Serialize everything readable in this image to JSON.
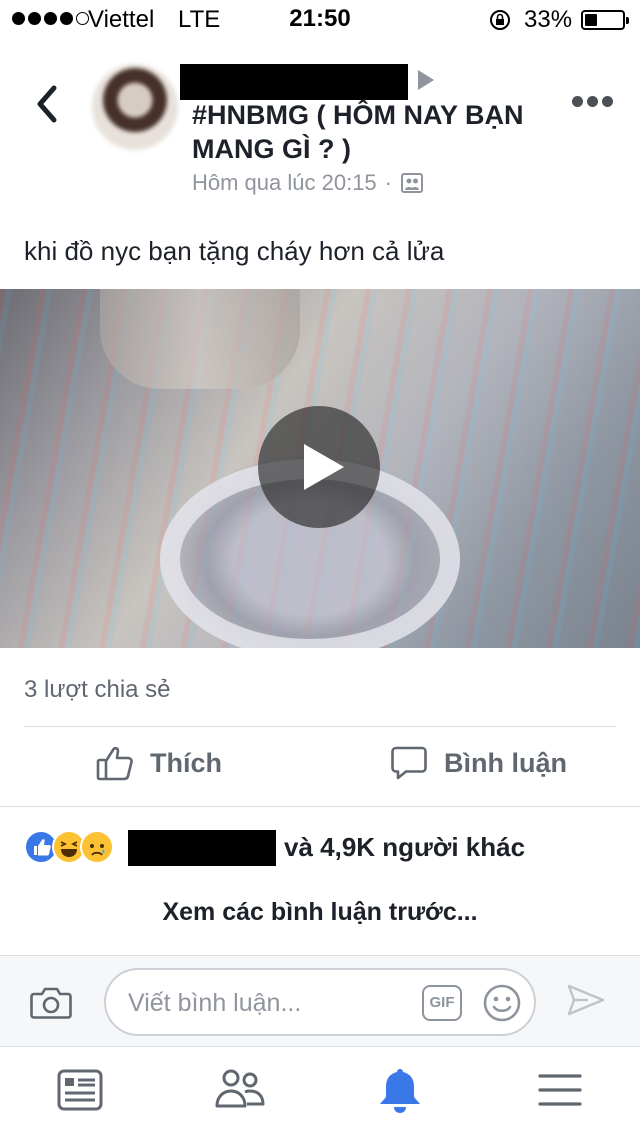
{
  "status_bar": {
    "carrier": "Viettel",
    "network": "LTE",
    "time": "21:50",
    "battery_percent_label": "33%",
    "battery_level": 0.33,
    "signal_bars_filled": 4,
    "signal_bars_total": 5
  },
  "post": {
    "group_name": "#HNBMG ( HÔM NAY BẠN MANG GÌ ? )",
    "timestamp": "Hôm qua lúc 20:15",
    "separator": "·",
    "privacy_icon": "group-photo-icon",
    "text": "khi đồ nyc bạn tặng cháy hơn cả lửa",
    "shares": "3 lượt chia sẻ"
  },
  "actions": {
    "like_label": "Thích",
    "comment_label": "Bình luận"
  },
  "reactions": {
    "icons": [
      "like-reaction-icon",
      "haha-reaction-icon",
      "sad-reaction-icon"
    ],
    "others_text": "và 4,9K người khác"
  },
  "comments": {
    "view_previous": "Xem các bình luận trước...",
    "placeholder": "Viết bình luận...",
    "gif_label": "GIF"
  },
  "tabbar": {
    "tabs": [
      "news-feed-icon",
      "friends-icon",
      "notifications-icon",
      "menu-icon"
    ],
    "active_tab": "notifications-icon"
  },
  "colors": {
    "accent": "#3b78e7",
    "text_primary": "#1d2129",
    "text_secondary": "#606770",
    "meta": "#90949c"
  }
}
